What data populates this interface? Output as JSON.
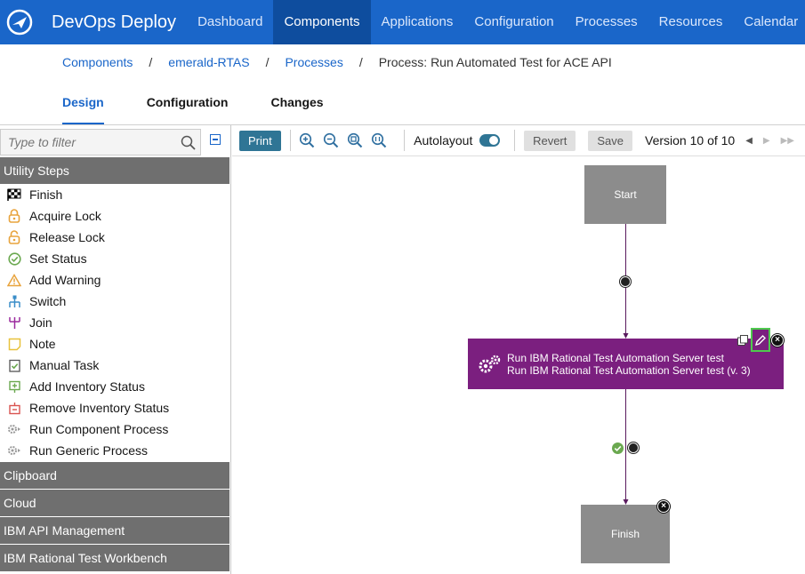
{
  "app": {
    "brand": "DevOps Deploy"
  },
  "nav": {
    "items": [
      {
        "label": "Dashboard"
      },
      {
        "label": "Components"
      },
      {
        "label": "Applications"
      },
      {
        "label": "Configuration"
      },
      {
        "label": "Processes"
      },
      {
        "label": "Resources"
      },
      {
        "label": "Calendar"
      }
    ],
    "active": "Components"
  },
  "breadcrumb": {
    "items": [
      "Components",
      "emerald-RTAS",
      "Processes"
    ],
    "current": "Process: Run Automated Test for ACE API",
    "separator": "/"
  },
  "tabs": [
    {
      "label": "Design"
    },
    {
      "label": "Configuration"
    },
    {
      "label": "Changes"
    }
  ],
  "sidebar": {
    "filter_placeholder": "Type to filter",
    "groups": [
      {
        "label": "Utility Steps"
      },
      {
        "label": "Clipboard"
      },
      {
        "label": "Cloud"
      },
      {
        "label": "IBM API Management"
      },
      {
        "label": "IBM Rational Test Workbench"
      }
    ],
    "steps": [
      {
        "label": "Finish",
        "icon": "checkered-flag-icon"
      },
      {
        "label": "Acquire Lock",
        "icon": "lock-icon"
      },
      {
        "label": "Release Lock",
        "icon": "unlock-icon"
      },
      {
        "label": "Set Status",
        "icon": "check-circle-icon"
      },
      {
        "label": "Add Warning",
        "icon": "warning-icon"
      },
      {
        "label": "Switch",
        "icon": "switch-icon"
      },
      {
        "label": "Join",
        "icon": "join-icon"
      },
      {
        "label": "Note",
        "icon": "note-icon"
      },
      {
        "label": "Manual Task",
        "icon": "manual-task-icon"
      },
      {
        "label": "Add Inventory Status",
        "icon": "add-inventory-icon"
      },
      {
        "label": "Remove Inventory Status",
        "icon": "remove-inventory-icon"
      },
      {
        "label": "Run Component Process",
        "icon": "run-component-process-icon"
      },
      {
        "label": "Run Generic Process",
        "icon": "run-generic-process-icon"
      }
    ]
  },
  "toolbar": {
    "print": "Print",
    "autolayout": "Autolayout",
    "revert": "Revert",
    "save": "Save",
    "version": "Version 10 of 10"
  },
  "canvas": {
    "start_label": "Start",
    "finish_label": "Finish",
    "step_line1": "Run IBM Rational Test Automation Server test",
    "step_line2": "Run IBM Rational Test Automation Server test (v. 3)"
  },
  "colors": {
    "nav_bg": "#1a66c9",
    "nav_active": "#0e4d9e",
    "accent": "#1a66c9",
    "step_node": "#7b1f7f",
    "group_header": "#6f6f6f",
    "toggle": "#2f7595"
  }
}
